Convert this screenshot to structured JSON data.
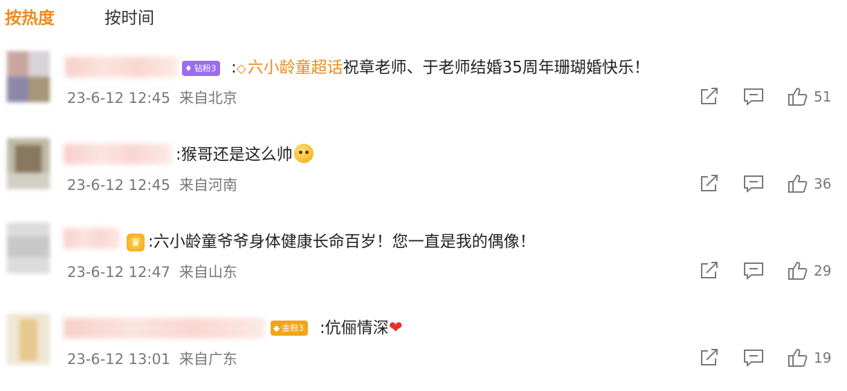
{
  "tabs": {
    "hot": "按热度",
    "time": "按时间"
  },
  "comments": [
    {
      "badge": "钻粉3",
      "topic": "六小龄童超话",
      "text": "祝章老师、于老师结婚35周年珊瑚婚快乐！",
      "time": "23-6-12 12:45",
      "location": "来自北京",
      "likes": "51"
    },
    {
      "text": "猴哥还是这么帅",
      "time": "23-6-12 12:45",
      "location": "来自河南",
      "likes": "36"
    },
    {
      "text": "六小龄童爷爷身体健康长命百岁！您一直是我的偶像！",
      "time": "23-6-12 12:47",
      "location": "来自山东",
      "likes": "29"
    },
    {
      "badge": "金粉3",
      "text": "伉俪情深",
      "time": "23-6-12 13:01",
      "location": "来自广东",
      "likes": "19"
    }
  ],
  "colors": {
    "accent": "#f08a1c",
    "badge_diamond": "#9a6cf0",
    "badge_gold": "#f3a51a",
    "heart": "#e5302c"
  },
  "icons": {
    "share": "share-icon",
    "reply": "comment-icon",
    "like": "thumbs-up-icon"
  }
}
